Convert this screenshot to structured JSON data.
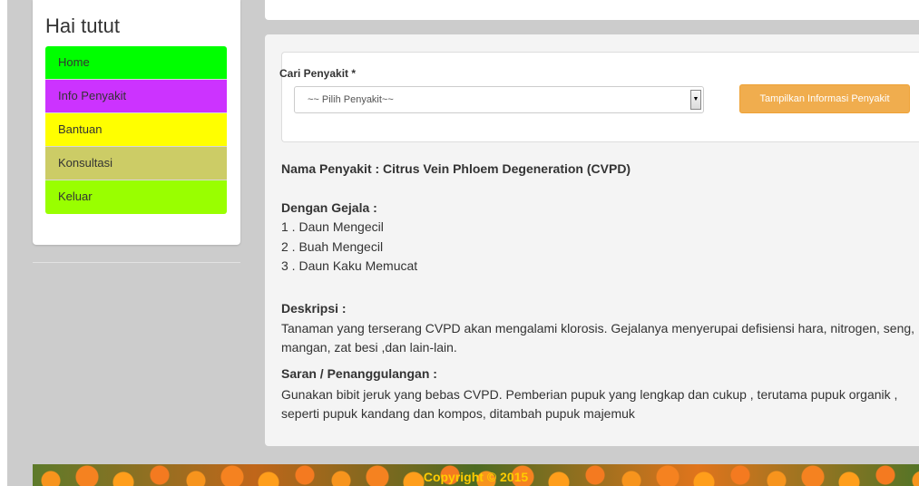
{
  "sidebar": {
    "greeting": "Hai tutut",
    "items": [
      {
        "label": "Home",
        "color": "#00ff00",
        "text_color": "#333333"
      },
      {
        "label": "Info Penyakit",
        "color": "#cc33ff",
        "text_color": "#333333"
      },
      {
        "label": "Bantuan",
        "color": "#ffff00",
        "text_color": "#333333"
      },
      {
        "label": "Konsultasi",
        "color": "#cccc66",
        "text_color": "#333333"
      },
      {
        "label": "Keluar",
        "color": "#99ff00",
        "text_color": "#333333"
      }
    ]
  },
  "search": {
    "label": "Cari Penyakit *",
    "select_value": "~~ Pilih Penyakit~~",
    "button_label": "Tampilkan Informasi Penyakit"
  },
  "disease": {
    "name_line": "Nama Penyakit : Citrus Vein Phloem Degeneration (CVPD)",
    "symptoms_title": "Dengan Gejala :",
    "symptoms": [
      "1 . Daun Mengecil",
      "2 . Buah Mengecil",
      "3 . Daun Kaku Memucat"
    ],
    "description_title": "Deskripsi :",
    "description": "Tanaman yang terserang CVPD akan mengalami klorosis. Gejalanya menyerupai defisiensi hara, nitrogen, seng, mangan, zat besi ,dan lain-lain.",
    "advice_title": "Saran / Penanggulangan :",
    "advice": "Gunakan bibit jeruk yang bebas CVPD. Pemberian pupuk yang lengkap dan cukup , terutama pupuk organik , seperti pupuk kandang dan kompos, ditambah pupuk majemuk"
  },
  "footer": {
    "copyright": "Copyright © 2015"
  }
}
